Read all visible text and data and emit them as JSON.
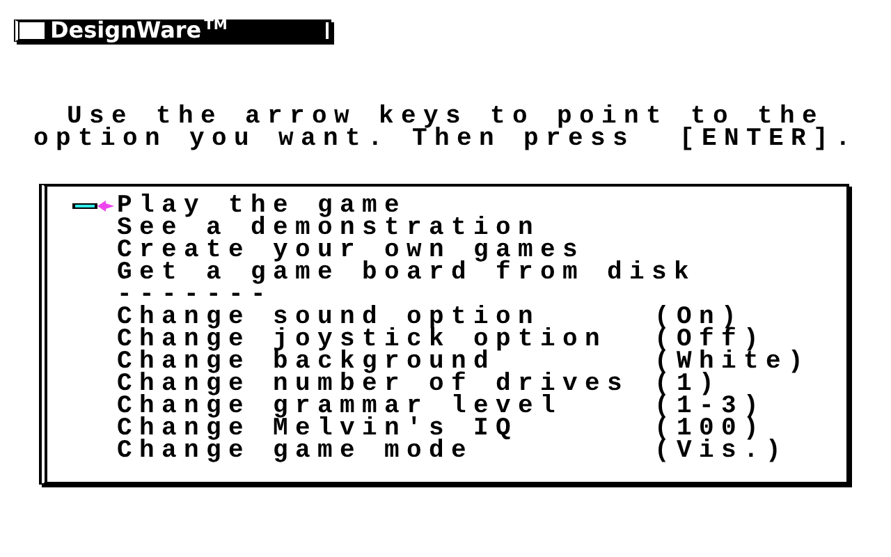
{
  "logo": {
    "text": "DesignWare",
    "mark": "TM"
  },
  "instructions": [
    "Use the arrow keys to point to the",
    "option you want. Then press  [ENTER]."
  ],
  "menu": [
    {
      "kind": "option",
      "label": "Play the game",
      "selected": true
    },
    {
      "kind": "option",
      "label": "See a demonstration",
      "selected": false
    },
    {
      "kind": "option",
      "label": "Create your own games",
      "selected": false
    },
    {
      "kind": "option",
      "label": "Get a game board from disk",
      "selected": false
    },
    {
      "kind": "separator",
      "label": "-------"
    },
    {
      "kind": "setting",
      "label": "Change sound option",
      "value": "(On)",
      "selected": false
    },
    {
      "kind": "setting",
      "label": "Change joystick option",
      "value": "(Off)",
      "selected": false
    },
    {
      "kind": "setting",
      "label": "Change background",
      "value": "(White)",
      "selected": false
    },
    {
      "kind": "setting",
      "label": "Change number of drives",
      "value": "(1)",
      "selected": false
    },
    {
      "kind": "setting",
      "label": "Change grammar level",
      "value": "(1-3)",
      "selected": false
    },
    {
      "kind": "setting",
      "label": "Change Melvin's IQ",
      "value": "(100)",
      "selected": false
    },
    {
      "kind": "setting",
      "label": "Change game mode",
      "value": "(Vis.)",
      "selected": false
    }
  ]
}
